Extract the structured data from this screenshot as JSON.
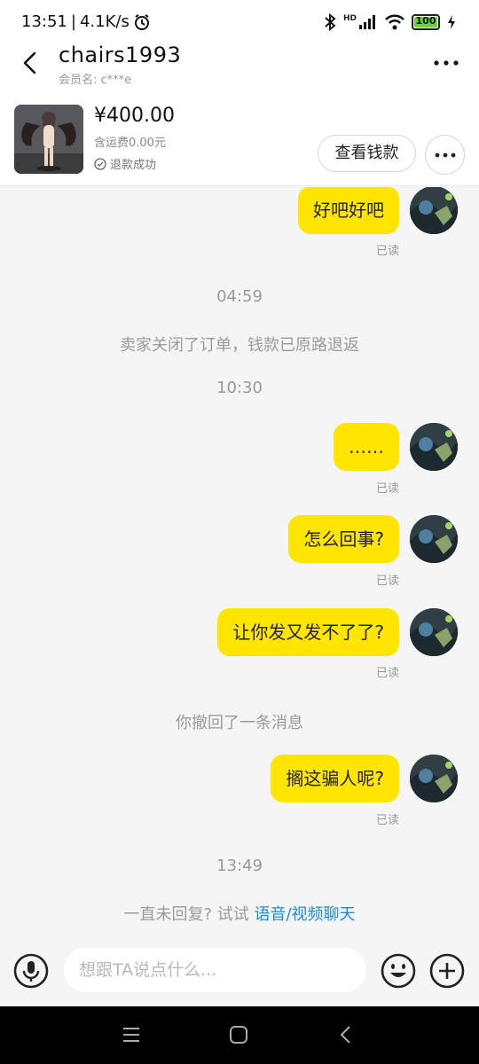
{
  "status": {
    "time": "13:51",
    "speed": "4.1K/s",
    "hd": "HD",
    "battery": "100"
  },
  "header": {
    "title": "chairs1993",
    "member_label": "会员名: c***e"
  },
  "product": {
    "price": "¥400.00",
    "shipping": "含运费0.00元",
    "refund_status": "退款成功",
    "view_button": "查看钱款"
  },
  "messages": {
    "m1": "好吧好吧",
    "m2": "……",
    "m3": "怎么回事?",
    "m4": "让你发又发不了了?",
    "m5": "搁这骗人呢?",
    "read": "已读"
  },
  "timeline": {
    "t1": "04:59",
    "sys1": "卖家关闭了订单，钱款已原路退返",
    "t2": "10:30",
    "sys2": "你撤回了一条消息",
    "t3": "13:49",
    "hint_prefix": "一直未回复? 试试 ",
    "hint_link": "语音/视频聊天"
  },
  "input": {
    "placeholder": "想跟TA说点什么..."
  },
  "colors": {
    "bubble": "#ffe500",
    "link": "#1a8cd8",
    "battery": "#6ad33a"
  },
  "icons": [
    "back-icon",
    "more-icon",
    "mic-icon",
    "emoji-icon",
    "plus-icon",
    "menu-icon",
    "home-icon",
    "nav-back-icon",
    "check-circle-icon",
    "bluetooth-icon",
    "signal-icon",
    "wifi-icon",
    "alarm-icon",
    "charging-icon"
  ]
}
